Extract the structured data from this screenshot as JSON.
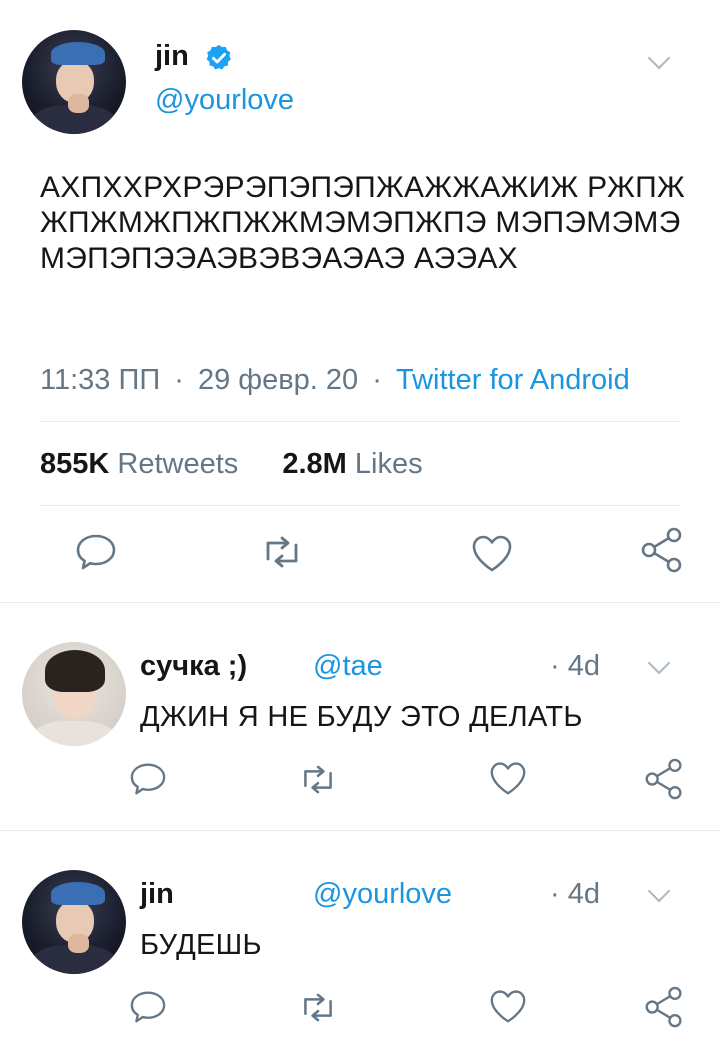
{
  "main_tweet": {
    "name": "jin",
    "handle": "@yourlove",
    "text": "АХПХХРХРЭРЭПЭПЭПЖАЖЖАЖИЖ РЖПЖЖПЖМЖПЖПЖЖМЭМЭПЖПЭ МЭПЭМЭМЭМЭПЭПЭЭАЭВЭВЭАЭАЭ АЭЭАХ",
    "time": "11:33 ПП",
    "sep1": "·",
    "date": "29 февр. 20",
    "sep2": "·",
    "source": "Twitter for Android",
    "retweets_count": "855K",
    "retweets_label": "Retweets",
    "likes_count": "2.8M",
    "likes_label": "Likes"
  },
  "replies": [
    {
      "name": "сучка ;)",
      "handle": "@tae",
      "time": "· 4d",
      "text": "ДЖИН Я НЕ БУДУ ЭТО ДЕЛАТЬ"
    },
    {
      "name": "jin",
      "handle": "@yourlove",
      "time": "· 4d",
      "text": "БУДЕШЬ"
    }
  ],
  "colors": {
    "accent": "#1b95e0",
    "muted": "#657786",
    "icon": "#657786",
    "divider": "#e6ecf0",
    "verified": "#1da1f2"
  },
  "icons": [
    "verified-badge-icon",
    "chevron-down-icon",
    "reply-icon",
    "retweet-icon",
    "like-icon",
    "share-icon"
  ]
}
